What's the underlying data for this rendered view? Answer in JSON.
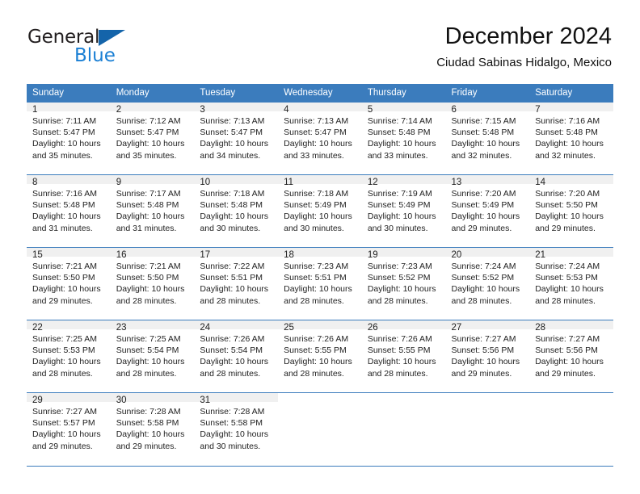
{
  "logo": {
    "word_top": "General",
    "word_bottom": "Blue",
    "triangle_color": "#1464aa",
    "blue_text_color": "#1a7fd4"
  },
  "header": {
    "title": "December 2024",
    "subtitle": "Ciudad Sabinas Hidalgo, Mexico"
  },
  "theme": {
    "header_row_bg": "#3b7cbd",
    "header_row_text": "#ffffff",
    "daynum_bg": "#f0f0f0",
    "grid_line": "#3b7cbd"
  },
  "calendar": {
    "weekday_headers": [
      "Sunday",
      "Monday",
      "Tuesday",
      "Wednesday",
      "Thursday",
      "Friday",
      "Saturday"
    ],
    "weeks": [
      [
        {
          "day": "1",
          "sunrise": "Sunrise: 7:11 AM",
          "sunset": "Sunset: 5:47 PM",
          "daylight_line1": "Daylight: 10 hours",
          "daylight_line2": "and 35 minutes."
        },
        {
          "day": "2",
          "sunrise": "Sunrise: 7:12 AM",
          "sunset": "Sunset: 5:47 PM",
          "daylight_line1": "Daylight: 10 hours",
          "daylight_line2": "and 35 minutes."
        },
        {
          "day": "3",
          "sunrise": "Sunrise: 7:13 AM",
          "sunset": "Sunset: 5:47 PM",
          "daylight_line1": "Daylight: 10 hours",
          "daylight_line2": "and 34 minutes."
        },
        {
          "day": "4",
          "sunrise": "Sunrise: 7:13 AM",
          "sunset": "Sunset: 5:47 PM",
          "daylight_line1": "Daylight: 10 hours",
          "daylight_line2": "and 33 minutes."
        },
        {
          "day": "5",
          "sunrise": "Sunrise: 7:14 AM",
          "sunset": "Sunset: 5:48 PM",
          "daylight_line1": "Daylight: 10 hours",
          "daylight_line2": "and 33 minutes."
        },
        {
          "day": "6",
          "sunrise": "Sunrise: 7:15 AM",
          "sunset": "Sunset: 5:48 PM",
          "daylight_line1": "Daylight: 10 hours",
          "daylight_line2": "and 32 minutes."
        },
        {
          "day": "7",
          "sunrise": "Sunrise: 7:16 AM",
          "sunset": "Sunset: 5:48 PM",
          "daylight_line1": "Daylight: 10 hours",
          "daylight_line2": "and 32 minutes."
        }
      ],
      [
        {
          "day": "8",
          "sunrise": "Sunrise: 7:16 AM",
          "sunset": "Sunset: 5:48 PM",
          "daylight_line1": "Daylight: 10 hours",
          "daylight_line2": "and 31 minutes."
        },
        {
          "day": "9",
          "sunrise": "Sunrise: 7:17 AM",
          "sunset": "Sunset: 5:48 PM",
          "daylight_line1": "Daylight: 10 hours",
          "daylight_line2": "and 31 minutes."
        },
        {
          "day": "10",
          "sunrise": "Sunrise: 7:18 AM",
          "sunset": "Sunset: 5:48 PM",
          "daylight_line1": "Daylight: 10 hours",
          "daylight_line2": "and 30 minutes."
        },
        {
          "day": "11",
          "sunrise": "Sunrise: 7:18 AM",
          "sunset": "Sunset: 5:49 PM",
          "daylight_line1": "Daylight: 10 hours",
          "daylight_line2": "and 30 minutes."
        },
        {
          "day": "12",
          "sunrise": "Sunrise: 7:19 AM",
          "sunset": "Sunset: 5:49 PM",
          "daylight_line1": "Daylight: 10 hours",
          "daylight_line2": "and 30 minutes."
        },
        {
          "day": "13",
          "sunrise": "Sunrise: 7:20 AM",
          "sunset": "Sunset: 5:49 PM",
          "daylight_line1": "Daylight: 10 hours",
          "daylight_line2": "and 29 minutes."
        },
        {
          "day": "14",
          "sunrise": "Sunrise: 7:20 AM",
          "sunset": "Sunset: 5:50 PM",
          "daylight_line1": "Daylight: 10 hours",
          "daylight_line2": "and 29 minutes."
        }
      ],
      [
        {
          "day": "15",
          "sunrise": "Sunrise: 7:21 AM",
          "sunset": "Sunset: 5:50 PM",
          "daylight_line1": "Daylight: 10 hours",
          "daylight_line2": "and 29 minutes."
        },
        {
          "day": "16",
          "sunrise": "Sunrise: 7:21 AM",
          "sunset": "Sunset: 5:50 PM",
          "daylight_line1": "Daylight: 10 hours",
          "daylight_line2": "and 28 minutes."
        },
        {
          "day": "17",
          "sunrise": "Sunrise: 7:22 AM",
          "sunset": "Sunset: 5:51 PM",
          "daylight_line1": "Daylight: 10 hours",
          "daylight_line2": "and 28 minutes."
        },
        {
          "day": "18",
          "sunrise": "Sunrise: 7:23 AM",
          "sunset": "Sunset: 5:51 PM",
          "daylight_line1": "Daylight: 10 hours",
          "daylight_line2": "and 28 minutes."
        },
        {
          "day": "19",
          "sunrise": "Sunrise: 7:23 AM",
          "sunset": "Sunset: 5:52 PM",
          "daylight_line1": "Daylight: 10 hours",
          "daylight_line2": "and 28 minutes."
        },
        {
          "day": "20",
          "sunrise": "Sunrise: 7:24 AM",
          "sunset": "Sunset: 5:52 PM",
          "daylight_line1": "Daylight: 10 hours",
          "daylight_line2": "and 28 minutes."
        },
        {
          "day": "21",
          "sunrise": "Sunrise: 7:24 AM",
          "sunset": "Sunset: 5:53 PM",
          "daylight_line1": "Daylight: 10 hours",
          "daylight_line2": "and 28 minutes."
        }
      ],
      [
        {
          "day": "22",
          "sunrise": "Sunrise: 7:25 AM",
          "sunset": "Sunset: 5:53 PM",
          "daylight_line1": "Daylight: 10 hours",
          "daylight_line2": "and 28 minutes."
        },
        {
          "day": "23",
          "sunrise": "Sunrise: 7:25 AM",
          "sunset": "Sunset: 5:54 PM",
          "daylight_line1": "Daylight: 10 hours",
          "daylight_line2": "and 28 minutes."
        },
        {
          "day": "24",
          "sunrise": "Sunrise: 7:26 AM",
          "sunset": "Sunset: 5:54 PM",
          "daylight_line1": "Daylight: 10 hours",
          "daylight_line2": "and 28 minutes."
        },
        {
          "day": "25",
          "sunrise": "Sunrise: 7:26 AM",
          "sunset": "Sunset: 5:55 PM",
          "daylight_line1": "Daylight: 10 hours",
          "daylight_line2": "and 28 minutes."
        },
        {
          "day": "26",
          "sunrise": "Sunrise: 7:26 AM",
          "sunset": "Sunset: 5:55 PM",
          "daylight_line1": "Daylight: 10 hours",
          "daylight_line2": "and 28 minutes."
        },
        {
          "day": "27",
          "sunrise": "Sunrise: 7:27 AM",
          "sunset": "Sunset: 5:56 PM",
          "daylight_line1": "Daylight: 10 hours",
          "daylight_line2": "and 29 minutes."
        },
        {
          "day": "28",
          "sunrise": "Sunrise: 7:27 AM",
          "sunset": "Sunset: 5:56 PM",
          "daylight_line1": "Daylight: 10 hours",
          "daylight_line2": "and 29 minutes."
        }
      ],
      [
        {
          "day": "29",
          "sunrise": "Sunrise: 7:27 AM",
          "sunset": "Sunset: 5:57 PM",
          "daylight_line1": "Daylight: 10 hours",
          "daylight_line2": "and 29 minutes."
        },
        {
          "day": "30",
          "sunrise": "Sunrise: 7:28 AM",
          "sunset": "Sunset: 5:58 PM",
          "daylight_line1": "Daylight: 10 hours",
          "daylight_line2": "and 29 minutes."
        },
        {
          "day": "31",
          "sunrise": "Sunrise: 7:28 AM",
          "sunset": "Sunset: 5:58 PM",
          "daylight_line1": "Daylight: 10 hours",
          "daylight_line2": "and 30 minutes."
        },
        {
          "day": "",
          "sunrise": "",
          "sunset": "",
          "daylight_line1": "",
          "daylight_line2": ""
        },
        {
          "day": "",
          "sunrise": "",
          "sunset": "",
          "daylight_line1": "",
          "daylight_line2": ""
        },
        {
          "day": "",
          "sunrise": "",
          "sunset": "",
          "daylight_line1": "",
          "daylight_line2": ""
        },
        {
          "day": "",
          "sunrise": "",
          "sunset": "",
          "daylight_line1": "",
          "daylight_line2": ""
        }
      ]
    ]
  }
}
